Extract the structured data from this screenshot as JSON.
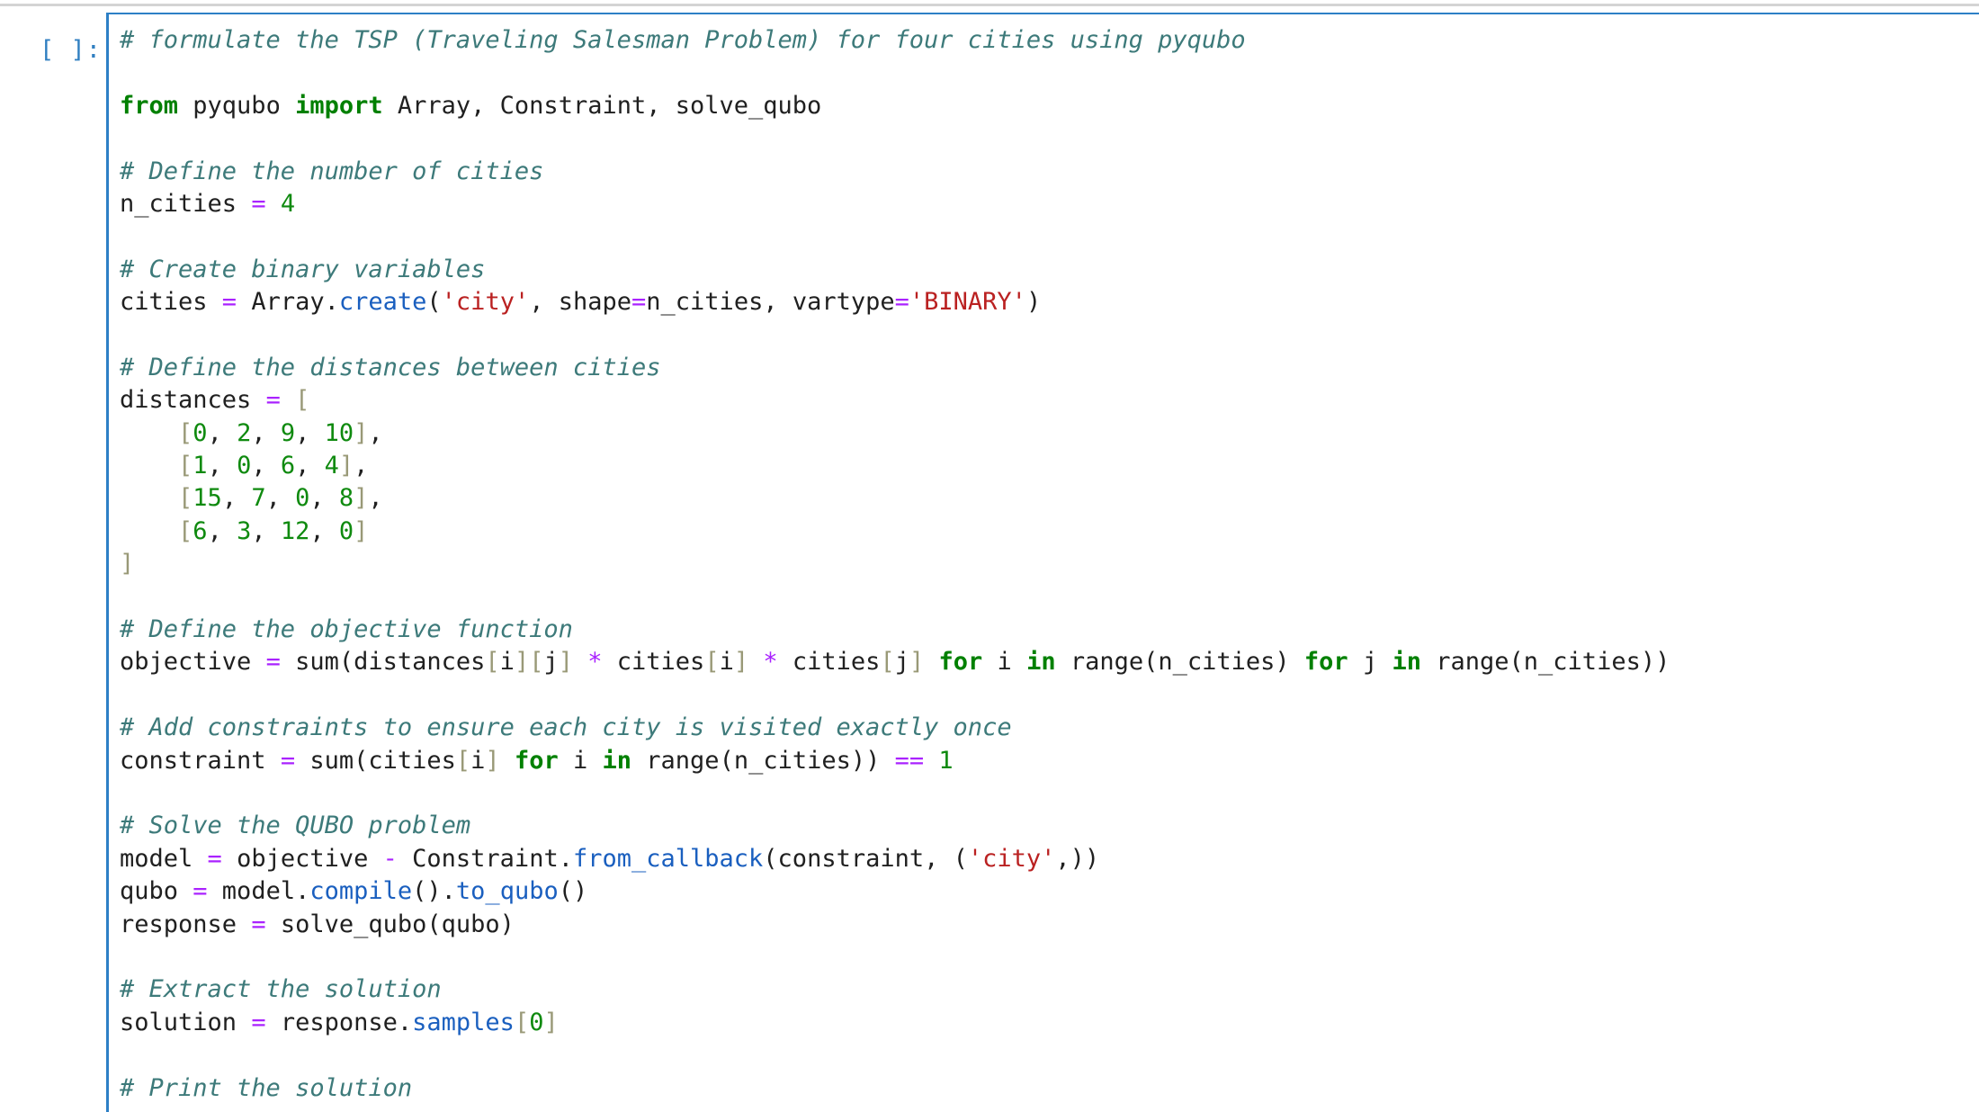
{
  "cell": {
    "prompt": "[ ]:",
    "lines": [
      [
        {
          "t": "cm",
          "v": "# formulate the TSP (Traveling Salesman Problem) for four cities using pyqubo"
        }
      ],
      [],
      [
        {
          "t": "kw",
          "v": "from"
        },
        {
          "t": "tx",
          "v": " pyqubo "
        },
        {
          "t": "kw",
          "v": "import"
        },
        {
          "t": "tx",
          "v": " Array, Constraint, solve_qubo"
        }
      ],
      [],
      [
        {
          "t": "cm",
          "v": "# Define the number of cities"
        }
      ],
      [
        {
          "t": "tx",
          "v": "n_cities "
        },
        {
          "t": "op",
          "v": "="
        },
        {
          "t": "tx",
          "v": " "
        },
        {
          "t": "num",
          "v": "4"
        }
      ],
      [],
      [
        {
          "t": "cm",
          "v": "# Create binary variables"
        }
      ],
      [
        {
          "t": "tx",
          "v": "cities "
        },
        {
          "t": "op",
          "v": "="
        },
        {
          "t": "tx",
          "v": " Array."
        },
        {
          "t": "at",
          "v": "create"
        },
        {
          "t": "tx",
          "v": "("
        },
        {
          "t": "str",
          "v": "'city'"
        },
        {
          "t": "tx",
          "v": ", shape"
        },
        {
          "t": "op",
          "v": "="
        },
        {
          "t": "tx",
          "v": "n_cities, vartype"
        },
        {
          "t": "op",
          "v": "="
        },
        {
          "t": "str",
          "v": "'BINARY'"
        },
        {
          "t": "tx",
          "v": ")"
        }
      ],
      [],
      [
        {
          "t": "cm",
          "v": "# Define the distances between cities"
        }
      ],
      [
        {
          "t": "tx",
          "v": "distances "
        },
        {
          "t": "op",
          "v": "="
        },
        {
          "t": "tx",
          "v": " "
        },
        {
          "t": "br",
          "v": "["
        }
      ],
      [
        {
          "t": "tx",
          "v": "    "
        },
        {
          "t": "br",
          "v": "["
        },
        {
          "t": "num",
          "v": "0"
        },
        {
          "t": "tx",
          "v": ", "
        },
        {
          "t": "num",
          "v": "2"
        },
        {
          "t": "tx",
          "v": ", "
        },
        {
          "t": "num",
          "v": "9"
        },
        {
          "t": "tx",
          "v": ", "
        },
        {
          "t": "num",
          "v": "10"
        },
        {
          "t": "br",
          "v": "]"
        },
        {
          "t": "tx",
          "v": ","
        }
      ],
      [
        {
          "t": "tx",
          "v": "    "
        },
        {
          "t": "br",
          "v": "["
        },
        {
          "t": "num",
          "v": "1"
        },
        {
          "t": "tx",
          "v": ", "
        },
        {
          "t": "num",
          "v": "0"
        },
        {
          "t": "tx",
          "v": ", "
        },
        {
          "t": "num",
          "v": "6"
        },
        {
          "t": "tx",
          "v": ", "
        },
        {
          "t": "num",
          "v": "4"
        },
        {
          "t": "br",
          "v": "]"
        },
        {
          "t": "tx",
          "v": ","
        }
      ],
      [
        {
          "t": "tx",
          "v": "    "
        },
        {
          "t": "br",
          "v": "["
        },
        {
          "t": "num",
          "v": "15"
        },
        {
          "t": "tx",
          "v": ", "
        },
        {
          "t": "num",
          "v": "7"
        },
        {
          "t": "tx",
          "v": ", "
        },
        {
          "t": "num",
          "v": "0"
        },
        {
          "t": "tx",
          "v": ", "
        },
        {
          "t": "num",
          "v": "8"
        },
        {
          "t": "br",
          "v": "]"
        },
        {
          "t": "tx",
          "v": ","
        }
      ],
      [
        {
          "t": "tx",
          "v": "    "
        },
        {
          "t": "br",
          "v": "["
        },
        {
          "t": "num",
          "v": "6"
        },
        {
          "t": "tx",
          "v": ", "
        },
        {
          "t": "num",
          "v": "3"
        },
        {
          "t": "tx",
          "v": ", "
        },
        {
          "t": "num",
          "v": "12"
        },
        {
          "t": "tx",
          "v": ", "
        },
        {
          "t": "num",
          "v": "0"
        },
        {
          "t": "br",
          "v": "]"
        }
      ],
      [
        {
          "t": "br",
          "v": "]"
        }
      ],
      [],
      [
        {
          "t": "cm",
          "v": "# Define the objective function"
        }
      ],
      [
        {
          "t": "tx",
          "v": "objective "
        },
        {
          "t": "op",
          "v": "="
        },
        {
          "t": "tx",
          "v": " sum(distances"
        },
        {
          "t": "br",
          "v": "["
        },
        {
          "t": "tx",
          "v": "i"
        },
        {
          "t": "br",
          "v": "]["
        },
        {
          "t": "tx",
          "v": "j"
        },
        {
          "t": "br",
          "v": "]"
        },
        {
          "t": "tx",
          "v": " "
        },
        {
          "t": "op",
          "v": "*"
        },
        {
          "t": "tx",
          "v": " cities"
        },
        {
          "t": "br",
          "v": "["
        },
        {
          "t": "tx",
          "v": "i"
        },
        {
          "t": "br",
          "v": "]"
        },
        {
          "t": "tx",
          "v": " "
        },
        {
          "t": "op",
          "v": "*"
        },
        {
          "t": "tx",
          "v": " cities"
        },
        {
          "t": "br",
          "v": "["
        },
        {
          "t": "tx",
          "v": "j"
        },
        {
          "t": "br",
          "v": "]"
        },
        {
          "t": "tx",
          "v": " "
        },
        {
          "t": "kw",
          "v": "for"
        },
        {
          "t": "tx",
          "v": " i "
        },
        {
          "t": "kw",
          "v": "in"
        },
        {
          "t": "tx",
          "v": " range(n_cities) "
        },
        {
          "t": "kw",
          "v": "for"
        },
        {
          "t": "tx",
          "v": " j "
        },
        {
          "t": "kw",
          "v": "in"
        },
        {
          "t": "tx",
          "v": " range(n_cities))"
        }
      ],
      [],
      [
        {
          "t": "cm",
          "v": "# Add constraints to ensure each city is visited exactly once"
        }
      ],
      [
        {
          "t": "tx",
          "v": "constraint "
        },
        {
          "t": "op",
          "v": "="
        },
        {
          "t": "tx",
          "v": " sum(cities"
        },
        {
          "t": "br",
          "v": "["
        },
        {
          "t": "tx",
          "v": "i"
        },
        {
          "t": "br",
          "v": "]"
        },
        {
          "t": "tx",
          "v": " "
        },
        {
          "t": "kw",
          "v": "for"
        },
        {
          "t": "tx",
          "v": " i "
        },
        {
          "t": "kw",
          "v": "in"
        },
        {
          "t": "tx",
          "v": " range(n_cities)) "
        },
        {
          "t": "op",
          "v": "=="
        },
        {
          "t": "tx",
          "v": " "
        },
        {
          "t": "num",
          "v": "1"
        }
      ],
      [],
      [
        {
          "t": "cm",
          "v": "# Solve the QUBO problem"
        }
      ],
      [
        {
          "t": "tx",
          "v": "model "
        },
        {
          "t": "op",
          "v": "="
        },
        {
          "t": "tx",
          "v": " objective "
        },
        {
          "t": "op",
          "v": "-"
        },
        {
          "t": "tx",
          "v": " Constraint."
        },
        {
          "t": "at",
          "v": "from_callback"
        },
        {
          "t": "tx",
          "v": "(constraint, ("
        },
        {
          "t": "str",
          "v": "'city'"
        },
        {
          "t": "tx",
          "v": ",))"
        }
      ],
      [
        {
          "t": "tx",
          "v": "qubo "
        },
        {
          "t": "op",
          "v": "="
        },
        {
          "t": "tx",
          "v": " model."
        },
        {
          "t": "at",
          "v": "compile"
        },
        {
          "t": "tx",
          "v": "()."
        },
        {
          "t": "at",
          "v": "to_qubo"
        },
        {
          "t": "tx",
          "v": "()"
        }
      ],
      [
        {
          "t": "tx",
          "v": "response "
        },
        {
          "t": "op",
          "v": "="
        },
        {
          "t": "tx",
          "v": " solve_qubo(qubo)"
        }
      ],
      [],
      [
        {
          "t": "cm",
          "v": "# Extract the solution"
        }
      ],
      [
        {
          "t": "tx",
          "v": "solution "
        },
        {
          "t": "op",
          "v": "="
        },
        {
          "t": "tx",
          "v": " response."
        },
        {
          "t": "at",
          "v": "samples"
        },
        {
          "t": "br",
          "v": "["
        },
        {
          "t": "num",
          "v": "0"
        },
        {
          "t": "br",
          "v": "]"
        }
      ],
      [],
      [
        {
          "t": "cm",
          "v": "# Print the solution"
        }
      ]
    ]
  }
}
